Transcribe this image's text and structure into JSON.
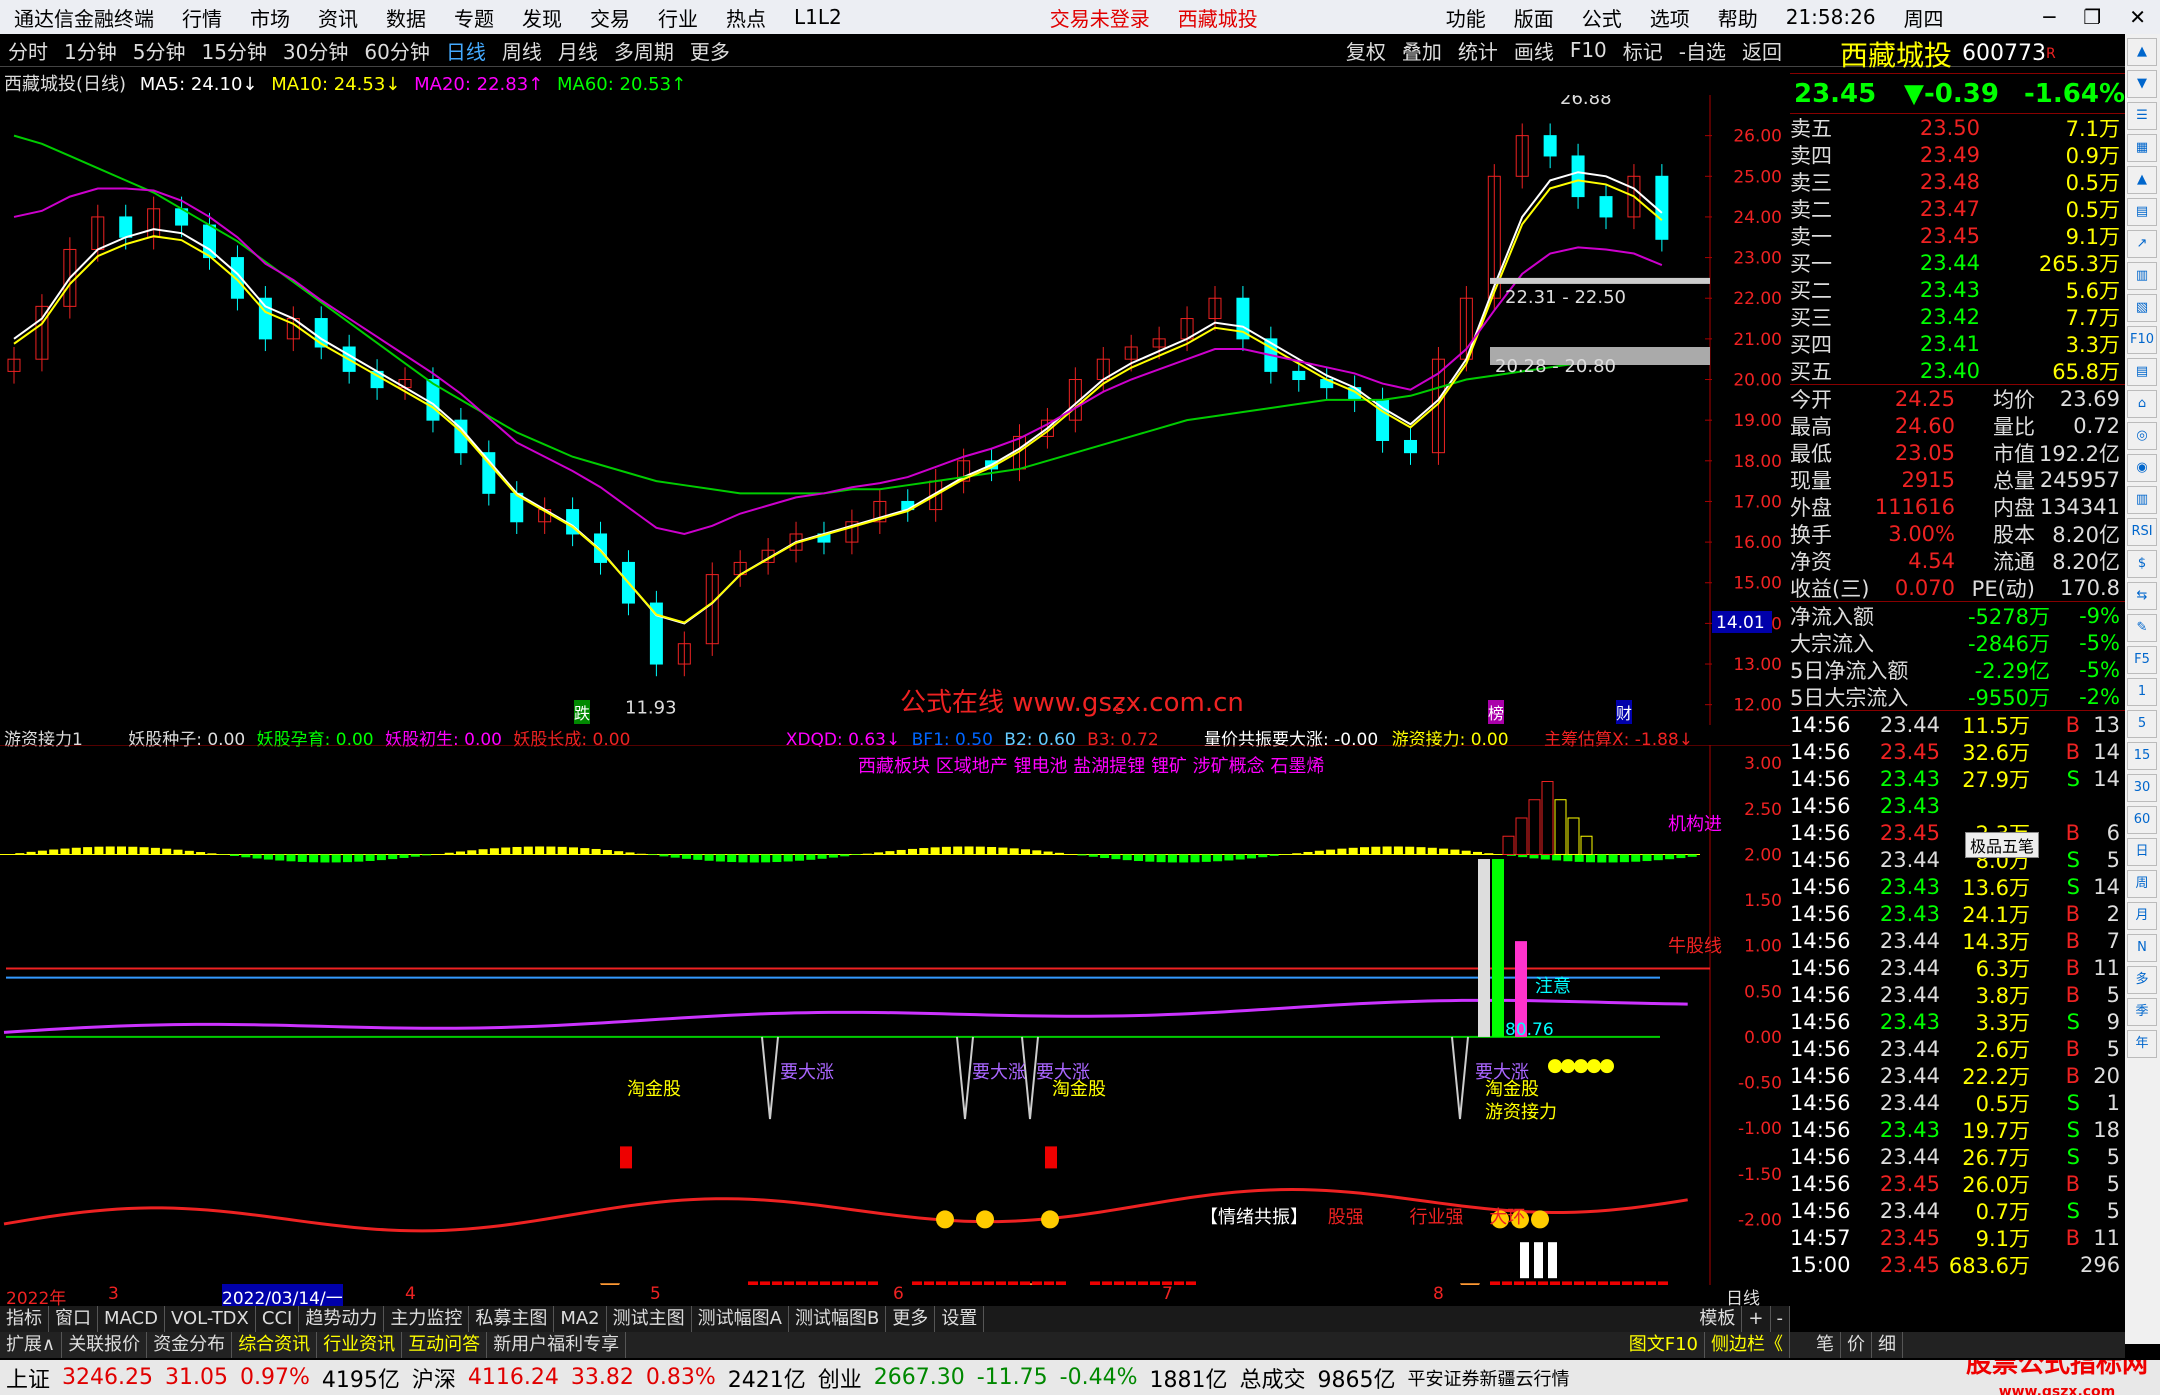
{
  "menu": {
    "app": "通达信金融终端",
    "items": [
      "行情",
      "市场",
      "资讯",
      "数据",
      "专题",
      "发现",
      "交易",
      "行业",
      "热点",
      "L1L2"
    ],
    "center1": "交易未登录",
    "center2": "西藏城投",
    "right": [
      "功能",
      "版面",
      "公式",
      "选项",
      "帮助"
    ],
    "time": "21:58:26",
    "weekday": "周四"
  },
  "periods": [
    "分时",
    "1分钟",
    "5分钟",
    "15分钟",
    "30分钟",
    "60分钟",
    "日线",
    "周线",
    "月线",
    "多周期",
    "更多"
  ],
  "tools": [
    "复权",
    "叠加",
    "统计",
    "画线",
    "F10",
    "标记",
    "-自选",
    "返回"
  ],
  "stock": {
    "name": "西藏城投",
    "code": "600773",
    "flag": "R",
    "price": "23.45",
    "change": "▼-0.39",
    "pct": "-1.64%"
  },
  "main_legend": {
    "title": "西藏城投(日线)",
    "ma5": "MA5: 24.10↓",
    "ma10": "MA10: 24.53↓",
    "ma20": "MA20: 22.83↑",
    "ma60": "MA60: 20.53↑"
  },
  "main_annotations": {
    "high": "26.88",
    "low": "11.93",
    "zone1": "22.31 - 22.50",
    "zone2": "20.28 - 20.80",
    "cur": "14.01",
    "mark_die": "跌",
    "mark_bang": "榜",
    "mark_cai": "财",
    "mark_s": "S",
    "watermark": "公式在线 www.gszx.com.cn"
  },
  "sub_legend": {
    "name": "游资接力1",
    "items": [
      "妖股种子: 0.00",
      "妖股孕育: 0.00",
      "妖股初生: 0.00",
      "妖股长成: 0.00",
      "XDQD: 0.63↓",
      "BF1: 0.50",
      "B2: 0.60",
      "B3: 0.72",
      "量价共振要大涨: -0.00",
      "游资接力: 0.00",
      "主筹估算X: -1.88↓"
    ]
  },
  "sub_text": {
    "sectors": [
      "西藏板块",
      "区域地产",
      "锂电池",
      "盐湖提锂",
      "锂矿",
      "涉矿概念",
      "石墨烯"
    ],
    "jigou": "机构进",
    "niugu": "牛股线",
    "zhuyi": "注意",
    "v8076": "80.76",
    "yaodazhang": "要大涨",
    "taojingu": "淘金股",
    "youzi": "游资接力",
    "qingxu": "【情绪共振】",
    "guqiang": "股强",
    "hangye": "行业强",
    "dahuan": "大环"
  },
  "timeline": {
    "year": "2022年",
    "cursor": "2022/03/14/一",
    "m3": "3",
    "m4": "4",
    "m5": "5",
    "m6": "6",
    "m7": "7",
    "m8": "8",
    "period": "日线"
  },
  "bottom_tabs": [
    "指标",
    "窗口",
    "MACD",
    "VOL-TDX",
    "CCI",
    "趋势动力",
    "主力监控",
    "私募主图",
    "MA2",
    "测试主图",
    "测试幅图A",
    "测试幅图B",
    "更多",
    "设置"
  ],
  "bottom_tabs2": [
    "扩展∧",
    "关联报价",
    "资金分布",
    "综合资讯",
    "行业资讯",
    "互动问答",
    "新用户福利专享"
  ],
  "right_tabs": {
    "mode": "模板",
    "plus": "+",
    "minus": "-",
    "f10": "图文F10",
    "side": "侧边栏《",
    "t1": "笔",
    "t2": "价",
    "t3": "细"
  },
  "order_book": {
    "sell": [
      [
        "卖五",
        "23.50",
        "7.1万"
      ],
      [
        "卖四",
        "23.49",
        "0.9万"
      ],
      [
        "卖三",
        "23.48",
        "0.5万"
      ],
      [
        "卖二",
        "23.47",
        "0.5万"
      ],
      [
        "卖一",
        "23.45",
        "9.1万"
      ]
    ],
    "buy": [
      [
        "买一",
        "23.44",
        "265.3万"
      ],
      [
        "买二",
        "23.43",
        "5.6万"
      ],
      [
        "买三",
        "23.42",
        "7.7万"
      ],
      [
        "买四",
        "23.41",
        "3.3万"
      ],
      [
        "买五",
        "23.40",
        "65.8万"
      ]
    ]
  },
  "stats": [
    [
      "今开",
      "24.25",
      "均价",
      "23.69"
    ],
    [
      "最高",
      "24.60",
      "量比",
      "0.72"
    ],
    [
      "最低",
      "23.05",
      "市值",
      "192.2亿"
    ],
    [
      "现量",
      "2915",
      "总量",
      "245957"
    ],
    [
      "外盘",
      "111616",
      "内盘",
      "134341"
    ],
    [
      "换手",
      "3.00%",
      "股本",
      "8.20亿"
    ],
    [
      "净资",
      "4.54",
      "流通",
      "8.20亿"
    ],
    [
      "收益(三)",
      "0.070",
      "PE(动)",
      "170.8"
    ]
  ],
  "flows": [
    [
      "净流入额",
      "-5278万",
      "-9%"
    ],
    [
      "大宗流入",
      "-2846万",
      "-5%"
    ],
    [
      "5日净流入额",
      "-2.29亿",
      "-5%"
    ],
    [
      "5日大宗流入",
      "-9550万",
      "-2%"
    ]
  ],
  "ticks": [
    [
      "14:56",
      "23.44",
      "11.5万",
      "B",
      "13"
    ],
    [
      "14:56",
      "23.45",
      "32.6万",
      "B",
      "14"
    ],
    [
      "14:56",
      "23.43",
      "27.9万",
      "S",
      "14"
    ],
    [
      "14:56",
      "23.43",
      "",
      "",
      " "
    ],
    [
      "14:56",
      "23.45",
      "2.3万",
      "B",
      "6"
    ],
    [
      "14:56",
      "23.44",
      "8.0万",
      "S",
      "5"
    ],
    [
      "14:56",
      "23.43",
      "13.6万",
      "S",
      "14"
    ],
    [
      "14:56",
      "23.43",
      "24.1万",
      "B",
      "2"
    ],
    [
      "14:56",
      "23.44",
      "14.3万",
      "B",
      "7"
    ],
    [
      "14:56",
      "23.44",
      "6.3万",
      "B",
      "11"
    ],
    [
      "14:56",
      "23.44",
      "3.8万",
      "B",
      "5"
    ],
    [
      "14:56",
      "23.43",
      "3.3万",
      "S",
      "9"
    ],
    [
      "14:56",
      "23.44",
      "2.6万",
      "B",
      "5"
    ],
    [
      "14:56",
      "23.44",
      "22.2万",
      "B",
      "20"
    ],
    [
      "14:56",
      "23.44",
      "0.5万",
      "S",
      "1"
    ],
    [
      "14:56",
      "23.43",
      "19.7万",
      "S",
      "18"
    ],
    [
      "14:56",
      "23.44",
      "26.7万",
      "S",
      "5"
    ],
    [
      "14:56",
      "23.45",
      "26.0万",
      "B",
      "5"
    ],
    [
      "14:56",
      "23.44",
      "0.7万",
      "S",
      "5"
    ],
    [
      "14:57",
      "23.45",
      "9.1万",
      "B",
      "11"
    ],
    [
      "15:00",
      "23.45",
      "683.6万",
      "",
      "296"
    ]
  ],
  "popup": "极品五笔",
  "status": {
    "sh": "上证",
    "sh_v": "3246.25",
    "sh_c": "31.05",
    "sh_p": "0.97%",
    "sh_a": "4195亿",
    "sz": "沪深",
    "sz_v": "4116.24",
    "sz_c": "33.82",
    "sz_p": "0.83%",
    "sz_a": "2421亿",
    "cy": "创业",
    "cy_v": "2667.30",
    "cy_c": "-11.75",
    "cy_p": "-0.44%",
    "cy_a": "1881亿",
    "zc": "总成交",
    "zc_v": "9865亿",
    "broker": "平安证券新疆云行情",
    "brand": "股票公式指标网",
    "brand_url": "www.gszx.com"
  },
  "chart_data": {
    "type": "candlestick",
    "title": "西藏城投(日线)",
    "ylim": [
      11.5,
      27
    ],
    "yticks": [
      "26.00",
      "25.00",
      "24.00",
      "23.00",
      "22.00",
      "21.00",
      "20.00",
      "19.00",
      "18.00",
      "17.00",
      "16.00",
      "15.00",
      "14.00",
      "13.00",
      "12.00"
    ],
    "sub_yticks": [
      "3.00",
      "2.50",
      "2.00",
      "1.50",
      "1.00",
      "0.50",
      "0.00",
      "-0.50",
      "-1.00",
      "-1.50",
      "-2.00"
    ],
    "close": [
      20.5,
      21.8,
      23.2,
      24.0,
      23.5,
      24.2,
      23.8,
      23.0,
      22.0,
      21.0,
      21.5,
      20.8,
      20.2,
      19.8,
      20.0,
      19.0,
      18.2,
      17.2,
      16.5,
      16.8,
      16.2,
      15.5,
      14.5,
      13.0,
      13.5,
      15.2,
      15.5,
      15.8,
      16.2,
      16.0,
      16.5,
      17.0,
      16.8,
      17.5,
      18.0,
      17.8,
      18.6,
      19.0,
      20.0,
      20.5,
      20.8,
      21.0,
      21.5,
      22.0,
      21.0,
      20.2,
      20.0,
      19.8,
      19.5,
      18.5,
      18.2,
      20.5,
      22.0,
      25.0,
      26.0,
      25.5,
      24.5,
      24.0,
      25.0,
      23.45
    ],
    "ma5": [
      21,
      21.5,
      22.5,
      23.2,
      23.5,
      23.7,
      23.6,
      23.2,
      22.6,
      21.8,
      21.5,
      21,
      20.6,
      20.2,
      19.8,
      19.4,
      18.8,
      18,
      17.2,
      16.8,
      16.4,
      15.8,
      15,
      14.2,
      14,
      14.5,
      15.2,
      15.6,
      16,
      16.2,
      16.4,
      16.6,
      16.8,
      17.2,
      17.6,
      17.9,
      18.3,
      18.8,
      19.4,
      20,
      20.4,
      20.7,
      21,
      21.4,
      21.3,
      20.9,
      20.5,
      20.1,
      19.8,
      19.3,
      18.9,
      19.5,
      20.5,
      22.3,
      24,
      24.9,
      25.1,
      25,
      24.7,
      24.1
    ],
    "ma60": [
      26,
      25.8,
      25.5,
      25.2,
      24.9,
      24.6,
      24.2,
      23.8,
      23.4,
      22.9,
      22.4,
      21.9,
      21.4,
      20.9,
      20.4,
      19.9,
      19.5,
      19.1,
      18.7,
      18.4,
      18.1,
      17.9,
      17.7,
      17.5,
      17.4,
      17.3,
      17.2,
      17.2,
      17.2,
      17.2,
      17.3,
      17.3,
      17.4,
      17.5,
      17.6,
      17.7,
      17.8,
      18,
      18.2,
      18.4,
      18.6,
      18.8,
      19,
      19.1,
      19.2,
      19.3,
      19.4,
      19.5,
      19.5,
      19.5,
      19.6,
      19.8,
      20,
      20.1,
      20.2,
      20.3,
      20.4,
      20.4,
      20.5,
      20.53
    ]
  }
}
